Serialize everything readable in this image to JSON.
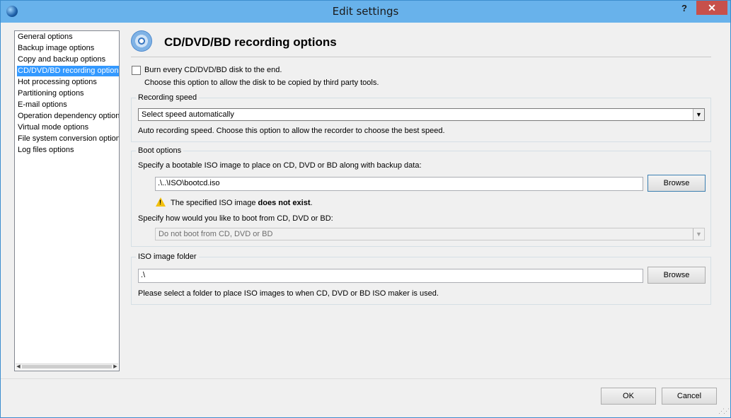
{
  "window": {
    "title": "Edit settings",
    "help_label": "?",
    "close_label": "✕"
  },
  "nav": {
    "items": [
      "General options",
      "Backup image options",
      "Copy and backup options",
      "CD/DVD/BD recording options",
      "Hot processing options",
      "Partitioning options",
      "E-mail options",
      "Operation dependency options",
      "Virtual mode options",
      "File system conversion options",
      "Log files options"
    ],
    "selected_index": 3
  },
  "header": {
    "title": "CD/DVD/BD recording options",
    "icon": "disc-icon"
  },
  "burn": {
    "checked": false,
    "label": "Burn every CD/DVD/BD disk to the end.",
    "description": "Choose this option to allow the disk to be copied by third party tools."
  },
  "recording_speed": {
    "group_label": "Recording speed",
    "selected": "Select speed automatically",
    "description": "Auto recording speed. Choose this option to allow the recorder to choose the best speed."
  },
  "boot": {
    "group_label": "Boot options",
    "prompt": "Specify a bootable ISO image to place on CD, DVD or BD along with backup data:",
    "path": ".\\..\\ISO\\bootcd.iso",
    "browse_label": "Browse",
    "warning_prefix": "The specified ISO image ",
    "warning_bold": "does not exist",
    "warning_suffix": ".",
    "boot_prompt": "Specify how would you like to boot from CD, DVD or BD:",
    "boot_selected": "Do not boot from CD, DVD or BD"
  },
  "iso_folder": {
    "group_label": "ISO image folder",
    "path": ".\\",
    "browse_label": "Browse",
    "description": "Please select a folder to place ISO images to when CD, DVD or BD ISO maker is used."
  },
  "footer": {
    "ok_label": "OK",
    "cancel_label": "Cancel"
  },
  "colors": {
    "titlebar": "#68b2eb",
    "selection": "#3399ff",
    "close": "#c7504b"
  }
}
